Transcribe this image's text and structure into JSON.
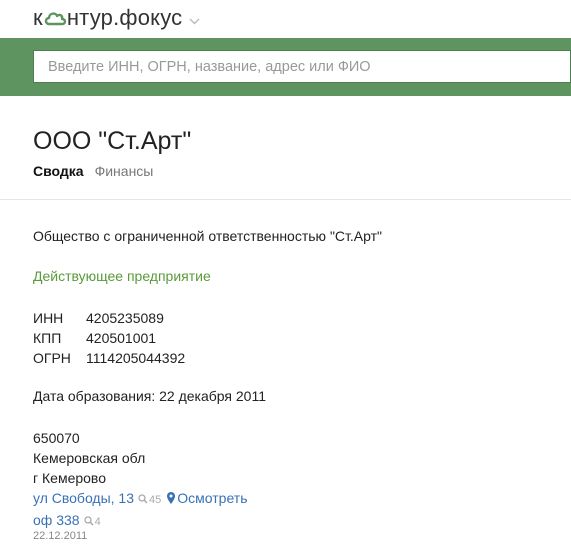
{
  "header": {
    "logo_left": "к",
    "logo_right": "нтур",
    "logo_dot": ".",
    "logo_product": "фокус"
  },
  "search": {
    "placeholder": "Введите ИНН, ОГРН, название, адрес или ФИО"
  },
  "company": {
    "short_name": "ООО \"Ст.Арт\"",
    "tabs": [
      {
        "label": "Сводка",
        "active": true
      },
      {
        "label": "Финансы",
        "active": false
      }
    ],
    "full_name": "Общество с ограниченной ответственностью \"Ст.Арт\"",
    "status": "Действующее предприятие",
    "requisites": [
      {
        "label": "ИНН",
        "value": "4205235089"
      },
      {
        "label": "КПП",
        "value": "420501001"
      },
      {
        "label": "ОГРН",
        "value": "1114205044392"
      }
    ],
    "founded": "Дата образования: 22 декабря 2011",
    "address": {
      "postcode": "650070",
      "region": "Кемеровская обл",
      "city": "г Кемерово",
      "street": "ул Свободы, 13",
      "street_count": "45",
      "view_label": "Осмотреть",
      "office": "оф 338",
      "office_count": "4",
      "date": "22.12.2011"
    }
  },
  "colors": {
    "green_bar": "#5e9460",
    "status_green": "#5a9a3a",
    "link_blue": "#3a71b5"
  }
}
